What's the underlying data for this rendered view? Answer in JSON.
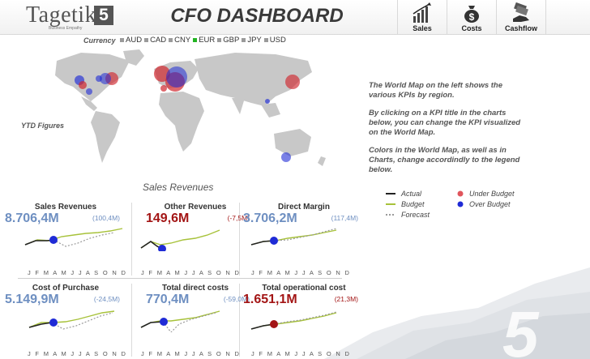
{
  "brand": {
    "logo_text": "Tagetik",
    "logo_mark": "5",
    "logo_tagline": "Business Empathy"
  },
  "header": {
    "title": "CFO DASHBOARD"
  },
  "nav": {
    "sales": "Sales",
    "costs": "Costs",
    "cashflow": "Cashflow"
  },
  "currency": {
    "label": "Currency",
    "options": [
      "AUD",
      "CAD",
      "CNY",
      "EUR",
      "GBP",
      "JPY",
      "USD"
    ],
    "selected": "EUR"
  },
  "map": {
    "ytd_label": "YTD Figures"
  },
  "info": {
    "p1": "The World Map on the left shows the various KPIs by region.",
    "p2": "By clicking on a KPI title in the charts below, you can change the KPI visualized on the World Map.",
    "p3": "Colors in the World Map, as well as in Charts, change accordindly to the legend below."
  },
  "legend": {
    "actual": "Actual",
    "budget": "Budget",
    "forecast": "Forecast",
    "under_budget": "Under Budget",
    "over_budget": "Over Budget"
  },
  "section_title": "Sales Revenues",
  "months": "J F M A M J J A S O N D",
  "kpis": [
    {
      "title": "Sales Revenues",
      "value": "8.706,4M",
      "variance": "(100,4M)",
      "status": "over"
    },
    {
      "title": "Other  Revenues",
      "value": "149,6M",
      "variance": "(-7,5M)",
      "status": "under"
    },
    {
      "title": "Direct Margin",
      "value": "3.706,2M",
      "variance": "(117,4M)",
      "status": "over"
    },
    {
      "title": "Cost of Purchase",
      "value": "5.149,9M",
      "variance": "(-24,5M)",
      "status": "over"
    },
    {
      "title": "Total direct costs",
      "value": "770,4M",
      "variance": "(-59,0M)",
      "status": "over"
    },
    {
      "title": "Total operational cost",
      "value": "1.651,1M",
      "variance": "(21,3M)",
      "status": "under"
    }
  ],
  "colors": {
    "over_budget": "#1f2bd6",
    "under_budget": "#d0262e",
    "budget": "#a7c23a",
    "actual": "#222222",
    "forecast": "#9a9a9a",
    "selected_currency": "#22b422"
  },
  "icons": {
    "sales": "bar-chart-icon",
    "costs": "money-bag-icon",
    "cashflow": "cash-hand-icon"
  }
}
